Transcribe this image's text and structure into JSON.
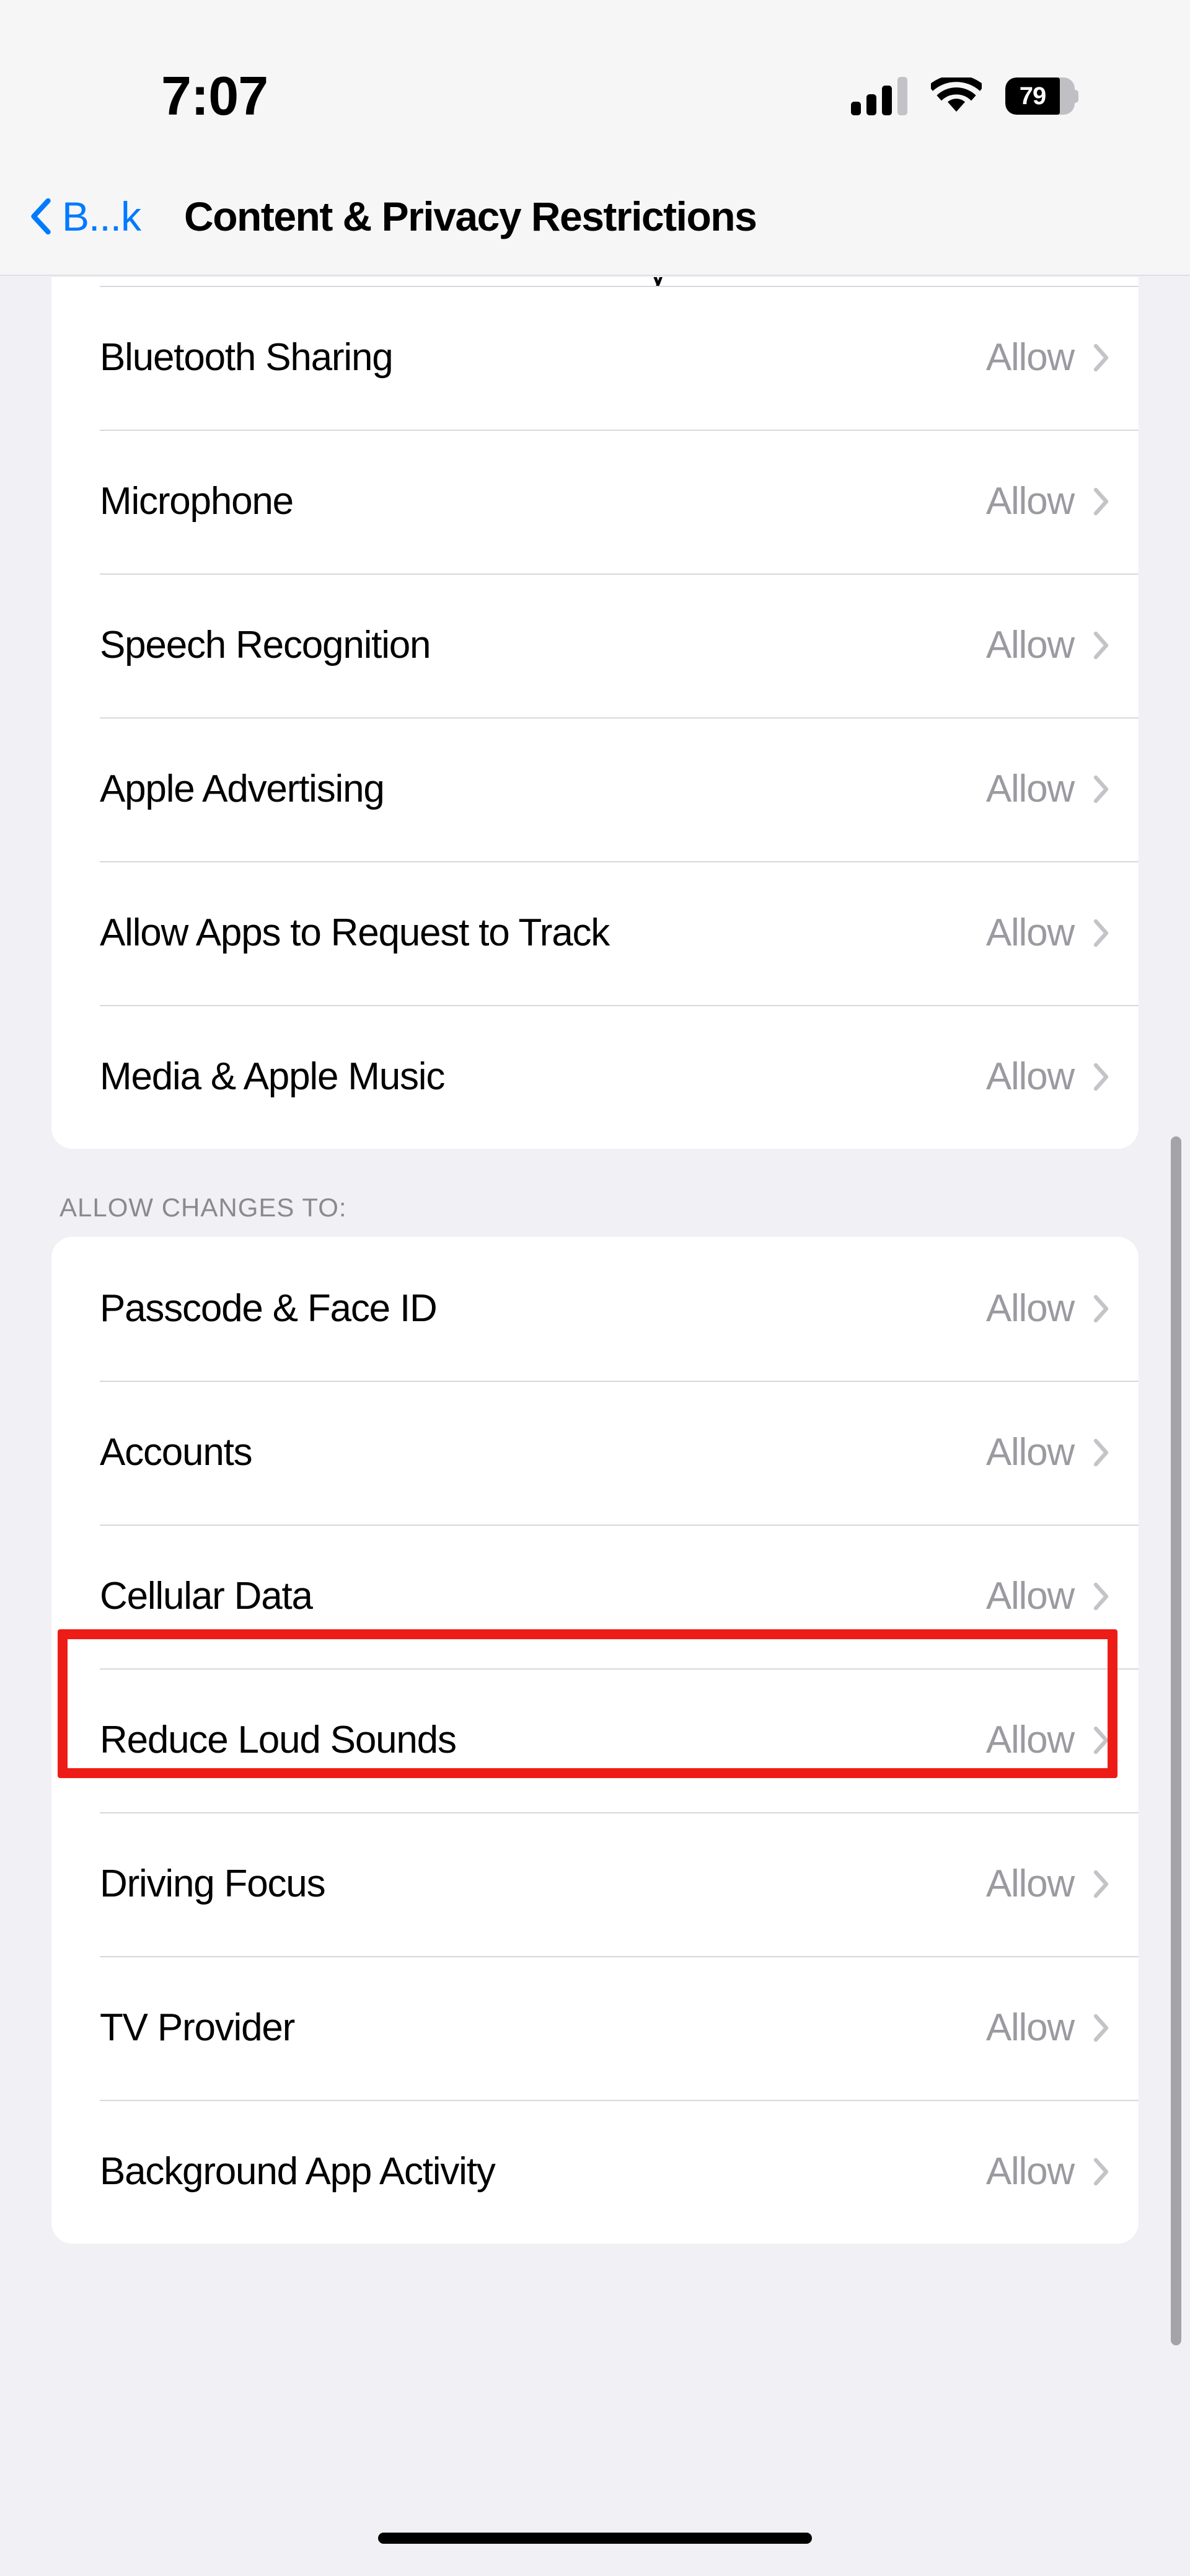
{
  "status_bar": {
    "time": "7:07",
    "signal_icon": "cellular-signal-icon",
    "signal_bars_filled": 3,
    "signal_bars_total": 4,
    "wifi_icon": "wifi-icon",
    "battery_icon": "battery-icon",
    "battery_percent": "79",
    "battery_level": 79
  },
  "nav": {
    "back_icon": "chevron-left-icon",
    "back_label": "B...k",
    "title": "Content & Privacy Restrictions",
    "accent_color": "#007AFF"
  },
  "sections": [
    {
      "header": "",
      "clipped_top": true,
      "partial_row_glyph": "y",
      "rows": [
        {
          "label": "Bluetooth Sharing",
          "value": "Allow",
          "chevron": "chevron-right-icon"
        },
        {
          "label": "Microphone",
          "value": "Allow",
          "chevron": "chevron-right-icon"
        },
        {
          "label": "Speech Recognition",
          "value": "Allow",
          "chevron": "chevron-right-icon"
        },
        {
          "label": "Apple Advertising",
          "value": "Allow",
          "chevron": "chevron-right-icon"
        },
        {
          "label": "Allow Apps to Request to Track",
          "value": "Allow",
          "chevron": "chevron-right-icon"
        },
        {
          "label": "Media & Apple Music",
          "value": "Allow",
          "chevron": "chevron-right-icon"
        }
      ]
    },
    {
      "header": "ALLOW CHANGES TO:",
      "clipped_top": false,
      "rows": [
        {
          "label": "Passcode & Face ID",
          "value": "Allow",
          "chevron": "chevron-right-icon"
        },
        {
          "label": "Accounts",
          "value": "Allow",
          "chevron": "chevron-right-icon"
        },
        {
          "label": "Cellular Data",
          "value": "Allow",
          "chevron": "chevron-right-icon",
          "highlighted": true
        },
        {
          "label": "Reduce Loud Sounds",
          "value": "Allow",
          "chevron": "chevron-right-icon"
        },
        {
          "label": "Driving Focus",
          "value": "Allow",
          "chevron": "chevron-right-icon"
        },
        {
          "label": "TV Provider",
          "value": "Allow",
          "chevron": "chevron-right-icon"
        },
        {
          "label": "Background App Activity",
          "value": "Allow",
          "chevron": "chevron-right-icon"
        }
      ]
    }
  ],
  "annotation": {
    "highlight_color": "#ED1C16",
    "highlight_target": "Cellular Data"
  },
  "colors": {
    "page_background": "#F0F0F5",
    "card_background": "#FFFFFF",
    "bar_background": "#F6F6F7",
    "value_text": "#9A9AA0",
    "header_text": "#8A8A8E",
    "separator": "#D8D8DC",
    "scrollbar": "#A3A3A8"
  },
  "home_indicator": "home-indicator"
}
